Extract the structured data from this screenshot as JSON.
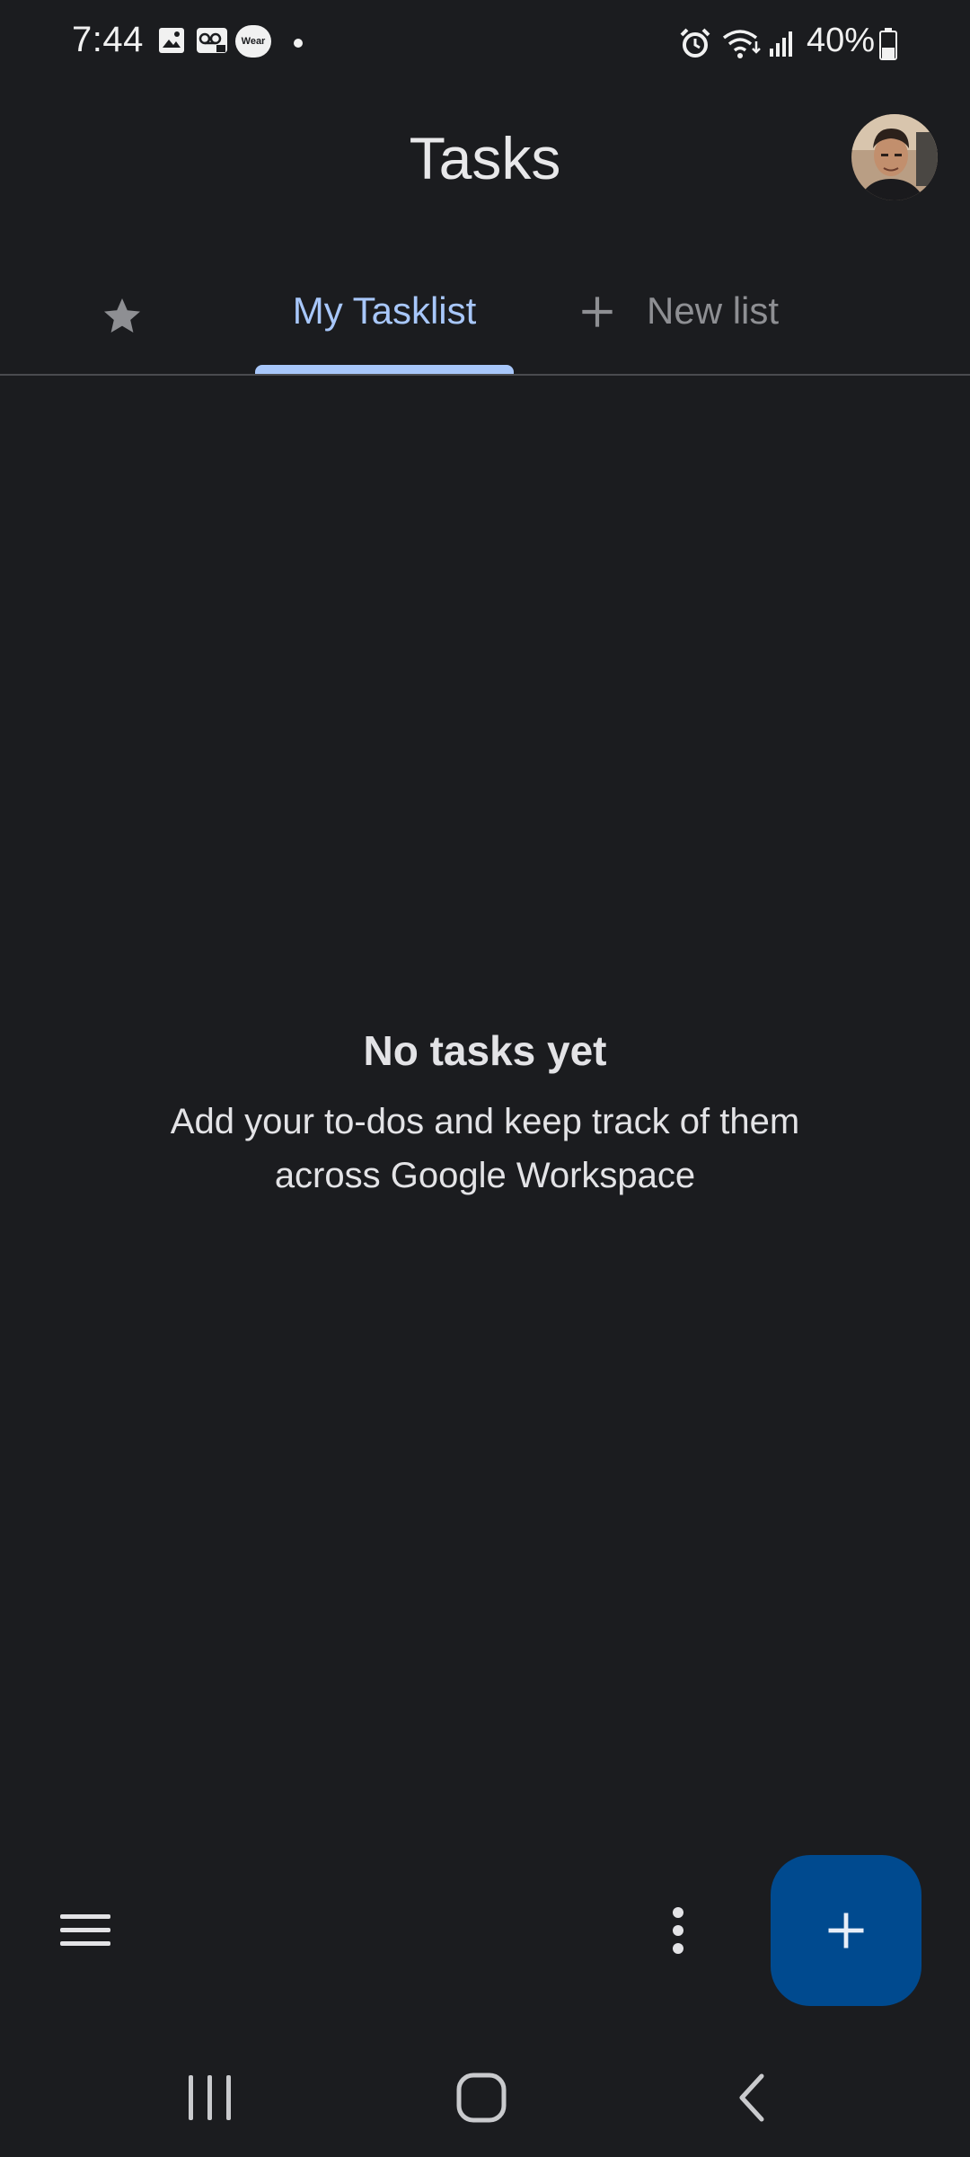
{
  "status_bar": {
    "time": "7:44",
    "battery_percent": "40%",
    "battery_level": 0.4,
    "notification_icons": [
      "gallery-icon",
      "voicemail-icon",
      "wear-icon",
      "dot-icon"
    ],
    "wear_badge_text": "Wear",
    "system_icons": [
      "alarm-icon",
      "wifi-icon",
      "signal-icon",
      "battery-icon"
    ]
  },
  "header": {
    "title": "Tasks"
  },
  "tabs": [
    {
      "id": "starred",
      "icon": "star-icon",
      "selected": false
    },
    {
      "id": "my-tasklist",
      "label": "My Tasklist",
      "selected": true
    },
    {
      "id": "new-list",
      "icon": "plus-icon",
      "label": "New list",
      "selected": false
    }
  ],
  "empty_state": {
    "title": "No tasks yet",
    "message": "Add your to-dos and keep track of them across Google Workspace"
  },
  "bottom_bar": {
    "menu_icon": "hamburger-menu-icon",
    "more_icon": "more-vert-icon",
    "fab_icon": "plus-icon"
  },
  "nav_bar": {
    "buttons": [
      "recent-apps-icon",
      "home-icon",
      "back-icon"
    ]
  },
  "colors": {
    "background": "#1b1c1f",
    "accent": "#a8c7fa",
    "fab": "#004a8f",
    "muted": "#8e8f93"
  }
}
